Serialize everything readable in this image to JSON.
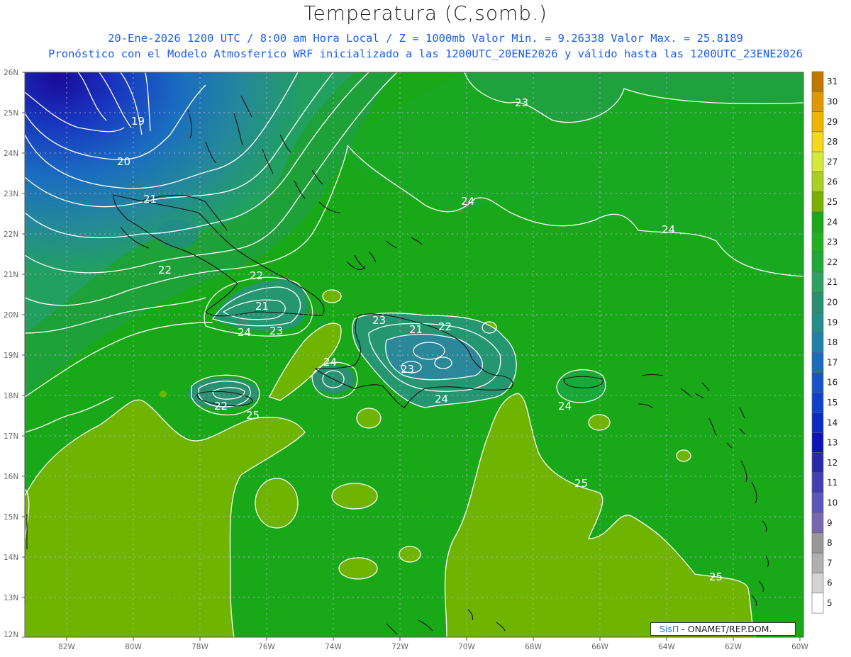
{
  "title": "Temperatura (C,somb.)",
  "subtitle_line1": "20-Ene-2026  1200 UTC / 8:00 am Hora Local / Z = 1000mb   Valor Min. = 9.26338  Valor Max. = 25.8189",
  "subtitle_line2": "Pronóstico con el Modelo Atmosferico WRF inicializado a las 1200UTC_20ENE2026 y válido hasta las  1200UTC_23ENE2026",
  "credit": {
    "brand": "SisΠ",
    "text": " - ONAMET/REP.DOM."
  },
  "map": {
    "lon_labels": [
      "82W",
      "80W",
      "78W",
      "76W",
      "74W",
      "72W",
      "70W",
      "68W",
      "66W",
      "64W",
      "62W",
      "60W"
    ],
    "lat_labels": [
      "26N",
      "25N",
      "24N",
      "23N",
      "22N",
      "21N",
      "20N",
      "19N",
      "18N",
      "17N",
      "16N",
      "15N",
      "14N",
      "13N",
      "12N"
    ],
    "contour_labels": [
      "19",
      "20",
      "21",
      "22",
      "22",
      "21",
      "23",
      "24",
      "23",
      "21",
      "22",
      "23",
      "24",
      "24",
      "22",
      "25",
      "24",
      "23",
      "24",
      "24",
      "25",
      "25"
    ]
  },
  "colorbar": {
    "levels": [
      "31",
      "30",
      "29",
      "28",
      "27",
      "26",
      "25",
      "24",
      "23",
      "22",
      "21",
      "20",
      "19",
      "18",
      "17",
      "16",
      "15",
      "14",
      "13",
      "12",
      "11",
      "10",
      "9",
      "8",
      "7",
      "6",
      "5"
    ],
    "colors": [
      "#c07800",
      "#e09800",
      "#f0b400",
      "#f4d81c",
      "#d6e83a",
      "#a8d020",
      "#7ab000",
      "#18a818",
      "#20b020",
      "#20a838",
      "#30a060",
      "#2a9070",
      "#268c88",
      "#2080a8",
      "#1c6cc0",
      "#1654c8",
      "#1040c8",
      "#0c2cc0",
      "#0a14b8",
      "#2828a8",
      "#4040b0",
      "#5858b8",
      "#7868b0",
      "#989898",
      "#b0b0b0",
      "#d4d4d4",
      "#ffffff"
    ]
  },
  "palette": {
    "dark": "#18a818",
    "light": "#6eb400",
    "cool": "#268c88"
  }
}
